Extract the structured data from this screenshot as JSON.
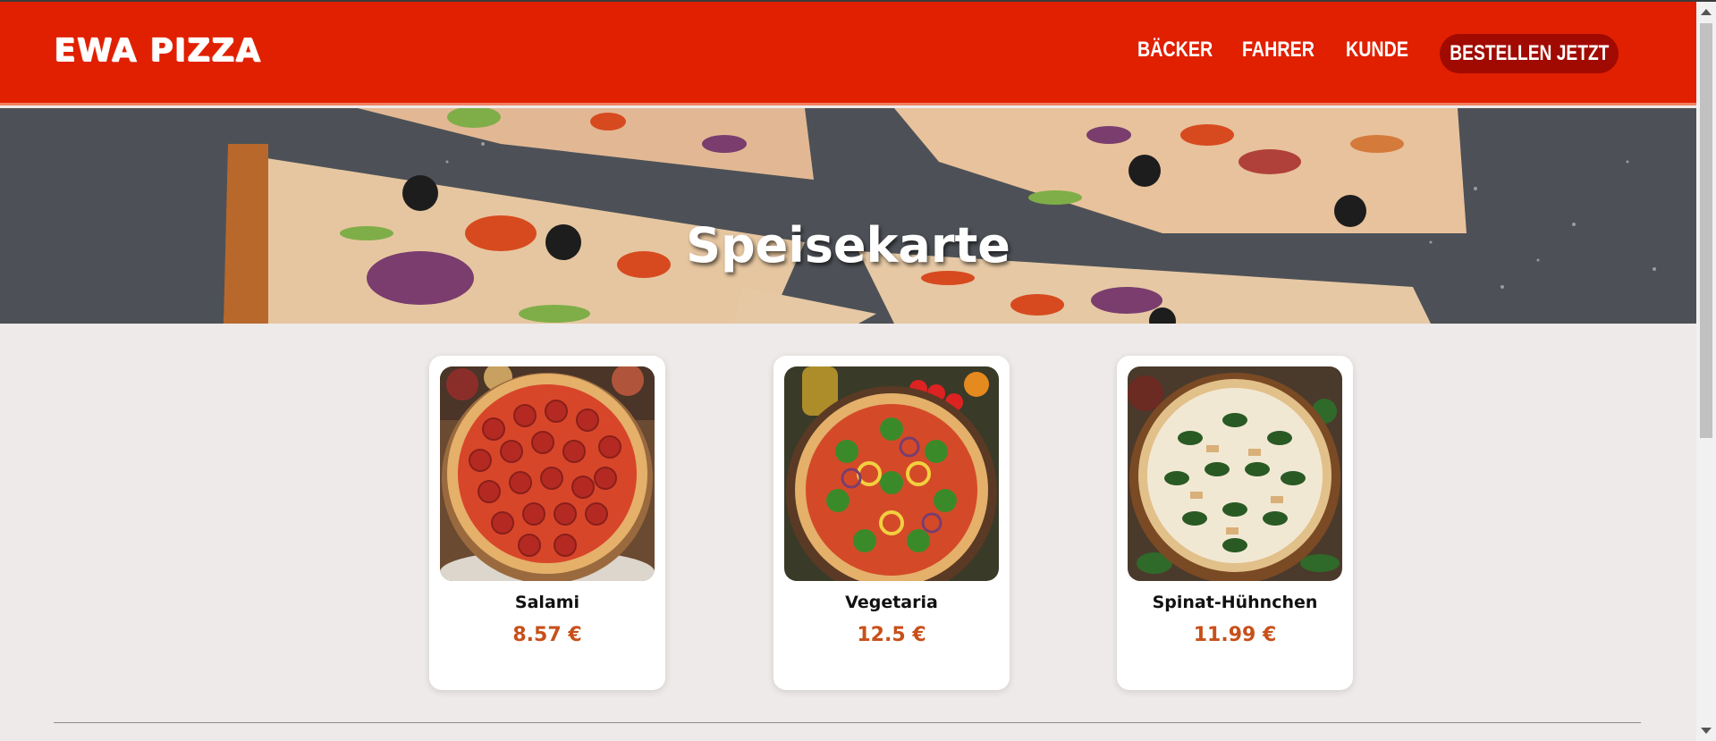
{
  "header": {
    "logo": "EWA PIZZA",
    "nav": [
      {
        "label": "BÄCKER"
      },
      {
        "label": "FAHRER"
      },
      {
        "label": "KUNDE"
      }
    ],
    "cta_label": "BESTELLEN JETZT"
  },
  "hero": {
    "title": "Speisekarte"
  },
  "menu": {
    "items": [
      {
        "name": "Salami",
        "price": "8.57 €",
        "image_icon": "salami-pizza-image"
      },
      {
        "name": "Vegetaria",
        "price": "12.5 €",
        "image_icon": "vegetarian-pizza-image"
      },
      {
        "name": "Spinat-Hühnchen",
        "price": "11.99 €",
        "image_icon": "spinach-chicken-pizza-image"
      }
    ]
  },
  "colors": {
    "header_bg": "#e02000",
    "cta_bg": "#a10a00",
    "price": "#c8501a",
    "page_bg": "#eeeae9"
  }
}
